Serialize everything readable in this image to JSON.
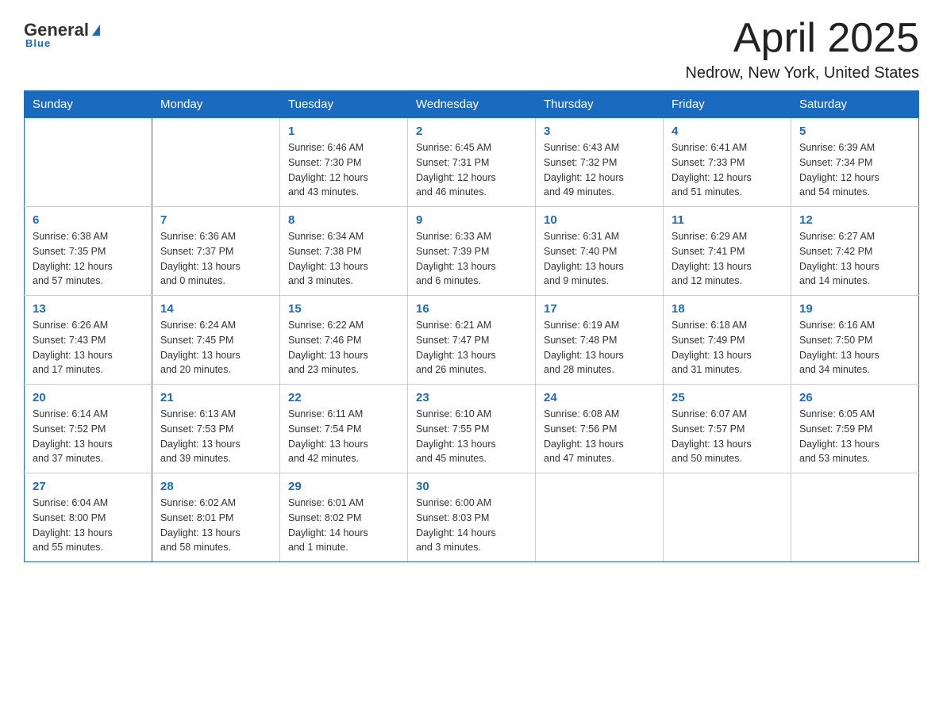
{
  "header": {
    "logo": {
      "general": "General",
      "blue": "Blue",
      "tagline": "Blue"
    },
    "title": "April 2025",
    "subtitle": "Nedrow, New York, United States"
  },
  "days_of_week": [
    "Sunday",
    "Monday",
    "Tuesday",
    "Wednesday",
    "Thursday",
    "Friday",
    "Saturday"
  ],
  "weeks": [
    [
      {
        "day": "",
        "info": ""
      },
      {
        "day": "",
        "info": ""
      },
      {
        "day": "1",
        "info": "Sunrise: 6:46 AM\nSunset: 7:30 PM\nDaylight: 12 hours\nand 43 minutes."
      },
      {
        "day": "2",
        "info": "Sunrise: 6:45 AM\nSunset: 7:31 PM\nDaylight: 12 hours\nand 46 minutes."
      },
      {
        "day": "3",
        "info": "Sunrise: 6:43 AM\nSunset: 7:32 PM\nDaylight: 12 hours\nand 49 minutes."
      },
      {
        "day": "4",
        "info": "Sunrise: 6:41 AM\nSunset: 7:33 PM\nDaylight: 12 hours\nand 51 minutes."
      },
      {
        "day": "5",
        "info": "Sunrise: 6:39 AM\nSunset: 7:34 PM\nDaylight: 12 hours\nand 54 minutes."
      }
    ],
    [
      {
        "day": "6",
        "info": "Sunrise: 6:38 AM\nSunset: 7:35 PM\nDaylight: 12 hours\nand 57 minutes."
      },
      {
        "day": "7",
        "info": "Sunrise: 6:36 AM\nSunset: 7:37 PM\nDaylight: 13 hours\nand 0 minutes."
      },
      {
        "day": "8",
        "info": "Sunrise: 6:34 AM\nSunset: 7:38 PM\nDaylight: 13 hours\nand 3 minutes."
      },
      {
        "day": "9",
        "info": "Sunrise: 6:33 AM\nSunset: 7:39 PM\nDaylight: 13 hours\nand 6 minutes."
      },
      {
        "day": "10",
        "info": "Sunrise: 6:31 AM\nSunset: 7:40 PM\nDaylight: 13 hours\nand 9 minutes."
      },
      {
        "day": "11",
        "info": "Sunrise: 6:29 AM\nSunset: 7:41 PM\nDaylight: 13 hours\nand 12 minutes."
      },
      {
        "day": "12",
        "info": "Sunrise: 6:27 AM\nSunset: 7:42 PM\nDaylight: 13 hours\nand 14 minutes."
      }
    ],
    [
      {
        "day": "13",
        "info": "Sunrise: 6:26 AM\nSunset: 7:43 PM\nDaylight: 13 hours\nand 17 minutes."
      },
      {
        "day": "14",
        "info": "Sunrise: 6:24 AM\nSunset: 7:45 PM\nDaylight: 13 hours\nand 20 minutes."
      },
      {
        "day": "15",
        "info": "Sunrise: 6:22 AM\nSunset: 7:46 PM\nDaylight: 13 hours\nand 23 minutes."
      },
      {
        "day": "16",
        "info": "Sunrise: 6:21 AM\nSunset: 7:47 PM\nDaylight: 13 hours\nand 26 minutes."
      },
      {
        "day": "17",
        "info": "Sunrise: 6:19 AM\nSunset: 7:48 PM\nDaylight: 13 hours\nand 28 minutes."
      },
      {
        "day": "18",
        "info": "Sunrise: 6:18 AM\nSunset: 7:49 PM\nDaylight: 13 hours\nand 31 minutes."
      },
      {
        "day": "19",
        "info": "Sunrise: 6:16 AM\nSunset: 7:50 PM\nDaylight: 13 hours\nand 34 minutes."
      }
    ],
    [
      {
        "day": "20",
        "info": "Sunrise: 6:14 AM\nSunset: 7:52 PM\nDaylight: 13 hours\nand 37 minutes."
      },
      {
        "day": "21",
        "info": "Sunrise: 6:13 AM\nSunset: 7:53 PM\nDaylight: 13 hours\nand 39 minutes."
      },
      {
        "day": "22",
        "info": "Sunrise: 6:11 AM\nSunset: 7:54 PM\nDaylight: 13 hours\nand 42 minutes."
      },
      {
        "day": "23",
        "info": "Sunrise: 6:10 AM\nSunset: 7:55 PM\nDaylight: 13 hours\nand 45 minutes."
      },
      {
        "day": "24",
        "info": "Sunrise: 6:08 AM\nSunset: 7:56 PM\nDaylight: 13 hours\nand 47 minutes."
      },
      {
        "day": "25",
        "info": "Sunrise: 6:07 AM\nSunset: 7:57 PM\nDaylight: 13 hours\nand 50 minutes."
      },
      {
        "day": "26",
        "info": "Sunrise: 6:05 AM\nSunset: 7:59 PM\nDaylight: 13 hours\nand 53 minutes."
      }
    ],
    [
      {
        "day": "27",
        "info": "Sunrise: 6:04 AM\nSunset: 8:00 PM\nDaylight: 13 hours\nand 55 minutes."
      },
      {
        "day": "28",
        "info": "Sunrise: 6:02 AM\nSunset: 8:01 PM\nDaylight: 13 hours\nand 58 minutes."
      },
      {
        "day": "29",
        "info": "Sunrise: 6:01 AM\nSunset: 8:02 PM\nDaylight: 14 hours\nand 1 minute."
      },
      {
        "day": "30",
        "info": "Sunrise: 6:00 AM\nSunset: 8:03 PM\nDaylight: 14 hours\nand 3 minutes."
      },
      {
        "day": "",
        "info": ""
      },
      {
        "day": "",
        "info": ""
      },
      {
        "day": "",
        "info": ""
      }
    ]
  ]
}
